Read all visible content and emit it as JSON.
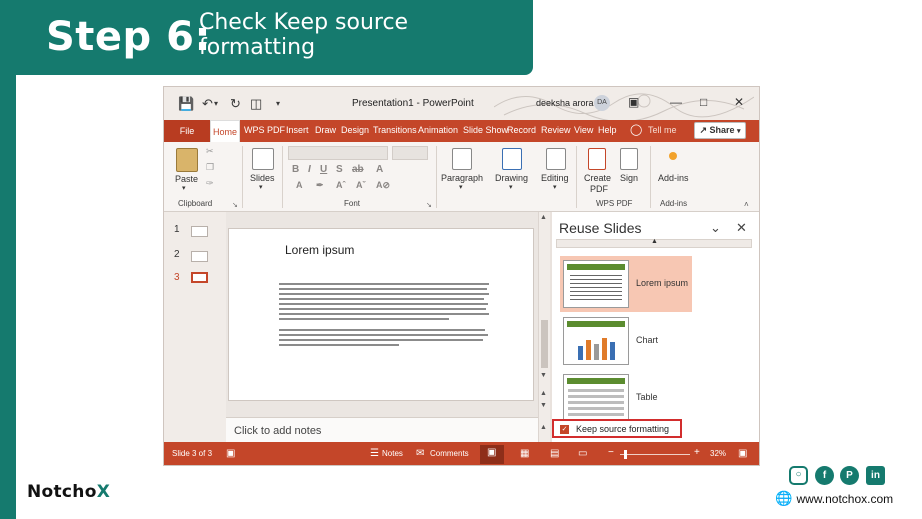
{
  "banner": {
    "step": "Step 6:",
    "instruction_line1": "Check Keep source",
    "instruction_line2": "formatting"
  },
  "titlebar": {
    "document_title": "Presentation1  -  PowerPoint",
    "user_name": "deeksha arora",
    "avatar_initials": "DA"
  },
  "ribbon_tabs": [
    "File",
    "Home",
    "WPS PDF",
    "Insert",
    "Draw",
    "Design",
    "Transitions",
    "Animations",
    "Slide Show",
    "Record",
    "Review",
    "View",
    "Help"
  ],
  "ribbon_tabs_visible": {
    "file": "File",
    "home": "Home",
    "wps": "WPS PDF",
    "insert": "Insert",
    "draw": "Draw",
    "design": "Design",
    "transitions": "Transitions",
    "animations": "Animation",
    "slideshow": "Slide Show",
    "record": "Record",
    "review": "Review",
    "view": "View",
    "help": "Help"
  },
  "tell_me": "Tell me",
  "share": "Share",
  "ribbon": {
    "paste": "Paste",
    "clipboard": "Clipboard",
    "slides": "Slides",
    "font": "Font",
    "paragraph": "Paragraph",
    "drawing": "Drawing",
    "editing": "Editing",
    "create_pdf_line1": "Create",
    "create_pdf_line2": "PDF",
    "sign": "Sign",
    "wps_pdf": "WPS PDF",
    "addins": "Add-ins",
    "addins_group": "Add-ins"
  },
  "thumbnails": {
    "one": "1",
    "two": "2",
    "three": "3"
  },
  "slide": {
    "title": "Lorem ipsum"
  },
  "notes_placeholder": "Click to add notes",
  "reuse_pane": {
    "title": "Reuse Slides",
    "items": [
      "Lorem ipsum",
      "Chart",
      "Table"
    ],
    "keep_label": "Keep source formatting",
    "keep_checked": true
  },
  "statusbar": {
    "slide_info": "Slide 3 of 3",
    "notes": "Notes",
    "comments": "Comments",
    "zoom": "32%"
  },
  "footer": {
    "logo_main": "Notcho",
    "logo_accent": "X",
    "website": "www.notchox.com"
  },
  "colors": {
    "brand_teal": "#157a6e",
    "ppt_red": "#c44629",
    "highlight": "#d22d2d"
  },
  "social_icons": [
    "instagram-icon",
    "facebook-icon",
    "pinterest-icon",
    "linkedin-icon"
  ]
}
